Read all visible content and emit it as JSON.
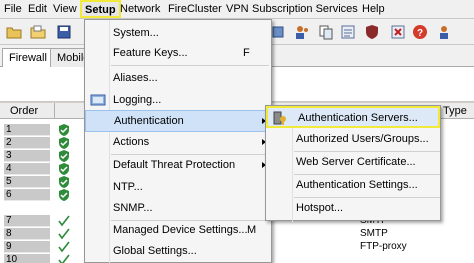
{
  "menubar": {
    "items": [
      "File",
      "Edit",
      "View",
      "Setup",
      "Network",
      "FireCluster",
      "VPN",
      "Subscription Services",
      "Help"
    ]
  },
  "toolbar": {
    "icons": [
      "open-folder-icon",
      "open-file-icon",
      "save-icon",
      "users-icon",
      "user-policy-icon",
      "copy-icon",
      "policy-icon",
      "shield-icon",
      "delete-icon",
      "help-icon",
      "tool-icon"
    ]
  },
  "tabs": [
    "Firewall",
    "Mobile"
  ],
  "table": {
    "headers": {
      "order": "Order",
      "type": "Type"
    },
    "rows": [
      {
        "order": "1",
        "icon": "shield-check-icon",
        "service": ""
      },
      {
        "order": "2",
        "icon": "shield-check-icon",
        "service": ""
      },
      {
        "order": "3",
        "icon": "shield-check-icon",
        "service": ""
      },
      {
        "order": "4",
        "icon": "shield-check-icon",
        "service": ""
      },
      {
        "order": "5",
        "icon": "shield-check-icon",
        "service": ""
      },
      {
        "order": "6",
        "icon": "shield-check-icon",
        "service": ""
      },
      {
        "order": "7",
        "icon": "check-icon",
        "service": "SMTP"
      },
      {
        "order": "8",
        "icon": "check-icon",
        "service": "SMTP"
      },
      {
        "order": "9",
        "icon": "check-icon",
        "service": "FTP-proxy"
      },
      {
        "order": "10",
        "icon": "check-icon",
        "service": ""
      }
    ]
  },
  "setup_menu": {
    "items": [
      {
        "label": "System...",
        "shortcut": "",
        "submenu": false,
        "icon": ""
      },
      {
        "label": "Feature Keys...",
        "shortcut": "F",
        "submenu": false,
        "icon": ""
      },
      {
        "label": "Aliases...",
        "shortcut": "",
        "submenu": false,
        "icon": ""
      },
      {
        "label": "Logging...",
        "shortcut": "",
        "submenu": false,
        "icon": "logging-icon"
      },
      {
        "label": "Authentication",
        "shortcut": "",
        "submenu": true,
        "icon": ""
      },
      {
        "label": "Actions",
        "shortcut": "",
        "submenu": true,
        "icon": ""
      },
      {
        "label": "Default Threat Protection",
        "shortcut": "",
        "submenu": true,
        "icon": ""
      },
      {
        "label": "NTP...",
        "shortcut": "",
        "submenu": false,
        "icon": ""
      },
      {
        "label": "SNMP...",
        "shortcut": "",
        "submenu": false,
        "icon": ""
      },
      {
        "label": "Managed Device Settings...",
        "shortcut": "M",
        "submenu": false,
        "icon": ""
      },
      {
        "label": "Global Settings...",
        "shortcut": "",
        "submenu": false,
        "icon": ""
      }
    ]
  },
  "auth_submenu": {
    "items": [
      {
        "label": "Authentication Servers...",
        "icon": "auth-servers-icon"
      },
      {
        "label": "Authorized Users/Groups...",
        "icon": ""
      },
      {
        "label": "Web Server Certificate...",
        "icon": ""
      },
      {
        "label": "Authentication Settings...",
        "icon": ""
      },
      {
        "label": "Hotspot...",
        "icon": ""
      }
    ]
  },
  "colors": {
    "highlight_outline": "#f2ea3a",
    "menu_highlight": "#cfe2f7",
    "shield_green": "#2e8b3a"
  }
}
